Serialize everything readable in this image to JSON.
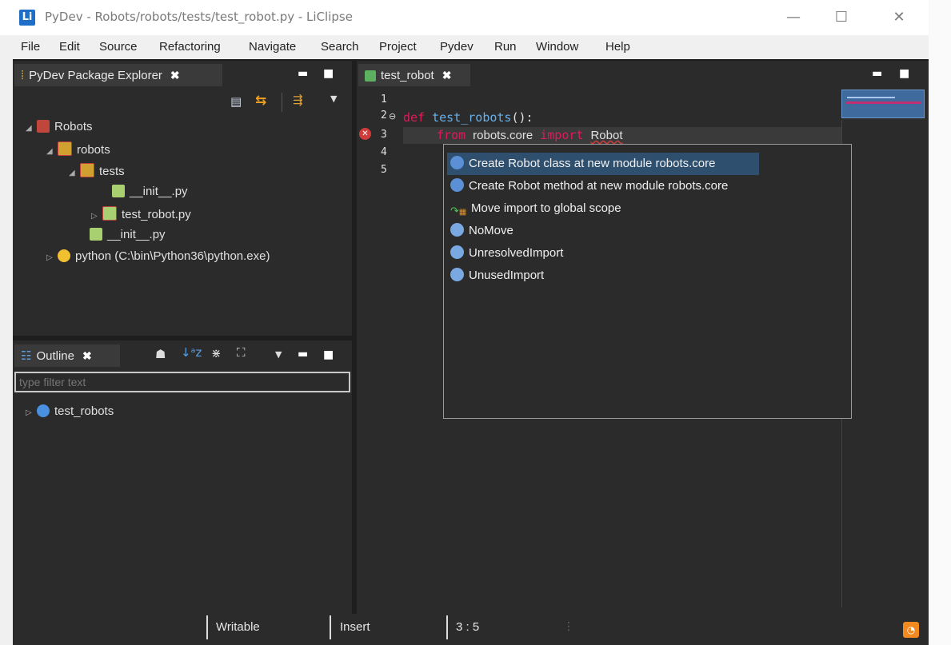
{
  "window": {
    "title": "PyDev - Robots/robots/tests/test_robot.py - LiClipse",
    "logo_letter": "Li",
    "minimize": "—",
    "maximize": "☐",
    "close": "✕"
  },
  "menu": [
    "File",
    "Edit",
    "Source",
    "Refactoring",
    "Navigate",
    "Search",
    "Project",
    "Pydev",
    "Run",
    "Window",
    "Help"
  ],
  "explorer": {
    "tab_label": "PyDev Package Explorer",
    "tree": [
      {
        "label": "Robots"
      },
      {
        "label": "robots"
      },
      {
        "label": "tests"
      },
      {
        "label": "__init__.py"
      },
      {
        "label": "test_robot.py"
      },
      {
        "label": "__init__.py"
      },
      {
        "label": "python  (C:\\bin\\Python36\\python.exe)"
      }
    ]
  },
  "outline": {
    "tab_label": "Outline",
    "filter_placeholder": "type filter text",
    "items": [
      {
        "label": "test_robots"
      }
    ]
  },
  "editor": {
    "tab_label": "test_robot",
    "line_numbers": [
      "1",
      "2",
      "3",
      "4",
      "5"
    ],
    "code": {
      "l2_kw": "def",
      "l2_name": "test_robots",
      "l2_rest": "():",
      "l3_from": "from",
      "l3_module": "robots.core",
      "l3_import": "import",
      "l3_name": "Robot"
    }
  },
  "quickfix": {
    "items": [
      {
        "label": "Create Robot class at new module robots.core",
        "selected": true
      },
      {
        "label": "Create Robot method at new module robots.core",
        "selected": false
      },
      {
        "label": "Move import to global scope",
        "selected": false
      },
      {
        "label": "NoMove",
        "selected": false
      },
      {
        "label": "UnresolvedImport",
        "selected": false
      },
      {
        "label": "UnusedImport",
        "selected": false
      }
    ]
  },
  "status": {
    "writable": "Writable",
    "insert": "Insert",
    "position": "3 : 5"
  },
  "colors": {
    "background_dark": "#2b2b2b",
    "keyword": "#e01a5a",
    "function": "#68b0e8",
    "error": "#d03c3c",
    "selection": "#2f4f6f"
  }
}
